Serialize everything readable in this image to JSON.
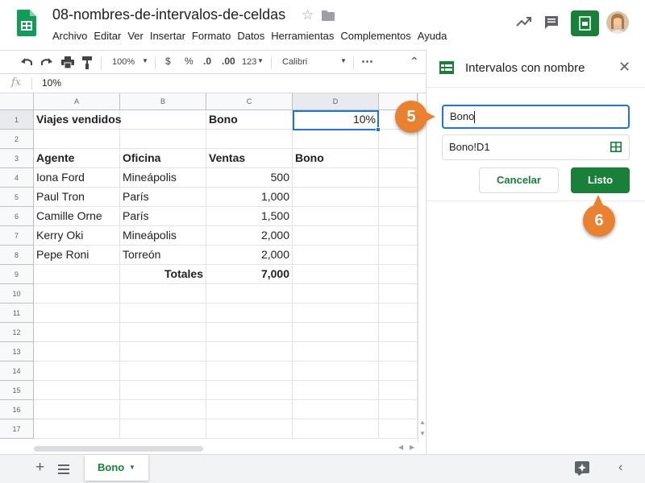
{
  "header": {
    "title": "08-nombres-de-intervalos-de-celdas",
    "menu": [
      "Archivo",
      "Editar",
      "Ver",
      "Insertar",
      "Formato",
      "Datos",
      "Herramientas",
      "Complementos",
      "Ayuda"
    ]
  },
  "toolbar": {
    "zoom": "100%",
    "currency": "$",
    "percent": "%",
    "dec_decrease": ".0",
    "dec_increase": ".00",
    "more_formats": "123",
    "font": "Calibri",
    "more": "⋯"
  },
  "formula_bar": {
    "fx": "fx",
    "value": "10%"
  },
  "grid": {
    "columns": [
      "A",
      "B",
      "C",
      "D"
    ],
    "rows": [
      "1",
      "2",
      "3",
      "4",
      "5",
      "6",
      "7",
      "8",
      "9",
      "10",
      "11",
      "12",
      "13",
      "14",
      "15",
      "16",
      "17"
    ],
    "cells": {
      "a1": "Viajes vendidos",
      "c1": "Bono",
      "d1": "10%",
      "a3": "Agente",
      "b3": "Oficina",
      "c3": "Ventas",
      "d3": "Bono",
      "a4": "Iona Ford",
      "b4": "Mineápolis",
      "c4": "500",
      "a5": "Paul Tron",
      "b5": "París",
      "c5": "1,000",
      "a6": "Camille Orne",
      "b6": "París",
      "c6": "1,500",
      "a7": "Kerry Oki",
      "b7": "Mineápolis",
      "c7": "2,000",
      "a8": "Pepe Roni",
      "b8": "Torreón",
      "c8": "2,000",
      "b9": "Totales",
      "c9": "7,000"
    }
  },
  "panel": {
    "title": "Intervalos con nombre",
    "name_value": "Bono",
    "range_value": "Bono!D1",
    "cancel_label": "Cancelar",
    "done_label": "Listo"
  },
  "steps": {
    "five": "5",
    "six": "6"
  },
  "sheet_tab": {
    "label": "Bono"
  },
  "colors": {
    "accent": "#188038",
    "step": "#e9812f",
    "selection": "#1a73e8"
  }
}
